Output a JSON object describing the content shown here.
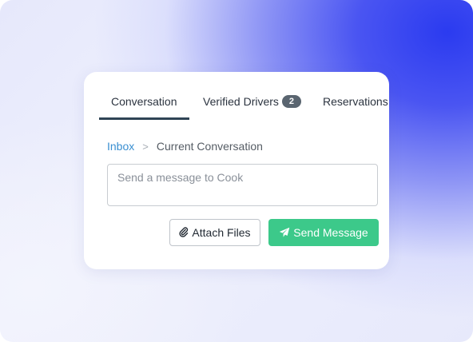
{
  "tabs": {
    "conversation": "Conversation",
    "verified_drivers": "Verified Drivers",
    "verified_drivers_count": "2",
    "reservations": "Reservations"
  },
  "breadcrumb": {
    "inbox": "Inbox",
    "separator": ">",
    "current": "Current Conversation"
  },
  "message": {
    "placeholder": "Send a message to Cook",
    "value": ""
  },
  "actions": {
    "attach_label": "Attach Files",
    "attach_icon": "paperclip-icon",
    "send_label": "Send Message",
    "send_icon": "paper-plane-icon"
  },
  "colors": {
    "send_button": "#3cc98a",
    "link": "#3a8fd1",
    "active_tab_underline": "#2f4455",
    "background_accent": "#2b3bf0"
  }
}
